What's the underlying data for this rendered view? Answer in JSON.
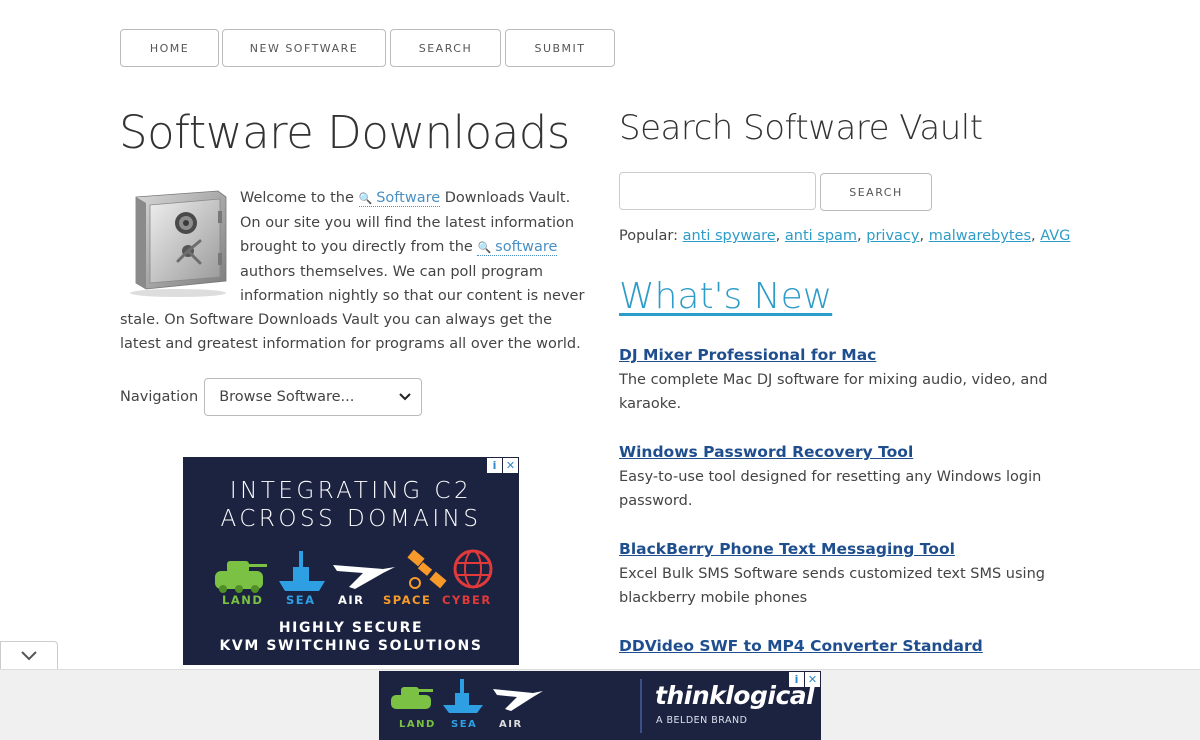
{
  "nav": {
    "items": [
      "HOME",
      "NEW SOFTWARE",
      "SEARCH",
      "SUBMIT"
    ]
  },
  "main": {
    "title": "Software Downloads",
    "intro": {
      "part1": "Welcome to the ",
      "kw1": "Software",
      "part2": " Downloads Vault. On our site you will find the latest information brought to you directly from the ",
      "kw2": "software",
      "part3": " authors themselves. We can poll program information nightly so that our content is never stale. On Software Downloads Vault you can always get the latest and greatest information for programs all over the world."
    },
    "navigation_label": "Navigation",
    "navigation_select": "Browse Software..."
  },
  "ad_left": {
    "headline_1": "INTEGRATING C2",
    "headline_2": "ACROSS DOMAINS",
    "labels": [
      "LAND",
      "SEA",
      "AIR",
      "SPACE",
      "CYBER"
    ],
    "label_colors": [
      "#7bc143",
      "#2f9fe3",
      "#ffffff",
      "#f79a2a",
      "#e23a3a"
    ],
    "bottom_1": "HIGHLY SECURE",
    "bottom_2": "KVM SWITCHING SOLUTIONS"
  },
  "sidebar": {
    "search_title": "Search Software Vault",
    "search_button": "SEARCH",
    "popular_label": "Popular:",
    "popular_links": [
      "anti spyware",
      "anti spam",
      "privacy",
      "malwarebytes",
      "AVG"
    ],
    "whats_new": "What's New",
    "entries": [
      {
        "title": "DJ Mixer Professional for Mac",
        "desc": "The complete Mac DJ software for mixing audio, video, and karaoke."
      },
      {
        "title": "Windows Password Recovery Tool",
        "desc": "Easy-to-use tool designed for resetting any Windows login password."
      },
      {
        "title": "BlackBerry Phone Text Messaging Tool",
        "desc": "Excel Bulk SMS Software sends customized text SMS using blackberry mobile phones"
      },
      {
        "title": "DDVideo SWF to MP4 Converter Standard",
        "desc": ""
      }
    ]
  },
  "ad_bottom": {
    "labels": [
      "LAND",
      "SEA",
      "AIR"
    ],
    "brand": "thinklogical",
    "sub": "A BELDEN BRAND"
  },
  "icons": {
    "search": "magnifier-icon",
    "dropdown": "chevron-down-icon",
    "collapse": "chevron-down-icon",
    "ad_info": "info-icon",
    "ad_close": "close-icon"
  },
  "colors": {
    "link": "#2e9cc9",
    "entry_link": "#1f4e8f",
    "ad_bg": "#1b2341"
  }
}
